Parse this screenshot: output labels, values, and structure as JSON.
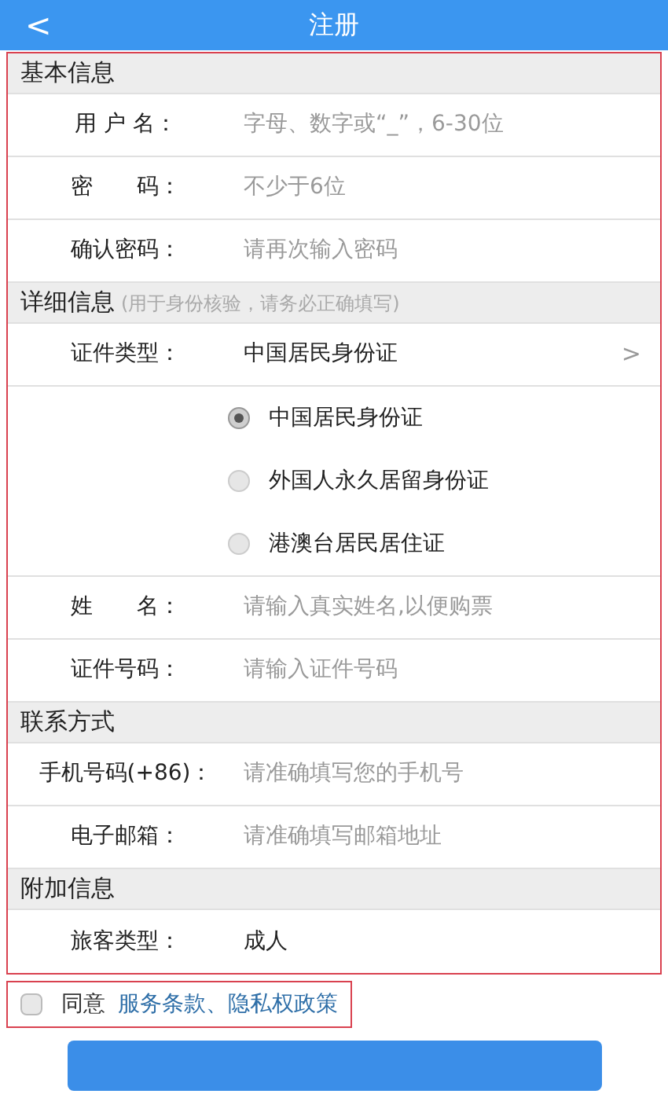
{
  "header": {
    "back": "<",
    "title": "注册"
  },
  "sections": [
    {
      "title": "基本信息",
      "rows": [
        {
          "kind": "field",
          "label": "用 户 名：",
          "placeholder": "字母、数字或“_”，6-30位"
        },
        {
          "kind": "field",
          "label": "密　　码：",
          "placeholder": "不少于6位"
        },
        {
          "kind": "field",
          "label": "确认密码：",
          "placeholder": "请再次输入密码"
        }
      ]
    },
    {
      "title": "详细信息",
      "note": "(用于身份核验，请务必正确填写)",
      "rows": [
        {
          "kind": "select",
          "label": "证件类型：",
          "value": "中国居民身份证",
          "chevron": ">"
        },
        {
          "kind": "radios",
          "options": [
            {
              "label": "中国居民身份证",
              "selected": true
            },
            {
              "label": "外国人永久居留身份证",
              "selected": false
            },
            {
              "label": "港澳台居民居住证",
              "selected": false
            }
          ]
        },
        {
          "kind": "field",
          "label": "姓　　名：",
          "placeholder": "请输入真实姓名,以便购票"
        },
        {
          "kind": "field",
          "label": "证件号码：",
          "placeholder": "请输入证件号码"
        }
      ]
    },
    {
      "title": "联系方式",
      "rows": [
        {
          "kind": "field",
          "label": "手机号码(+86)：",
          "placeholder": "请准确填写您的手机号"
        },
        {
          "kind": "field",
          "label": "电子邮箱：",
          "placeholder": "请准确填写邮箱地址"
        }
      ]
    },
    {
      "title": "附加信息",
      "rows": [
        {
          "kind": "value",
          "label": "旅客类型：",
          "value": "成人"
        }
      ]
    }
  ],
  "agree": {
    "checked": false,
    "prefix": "同意",
    "link": "服务条款、隐私权政策"
  }
}
